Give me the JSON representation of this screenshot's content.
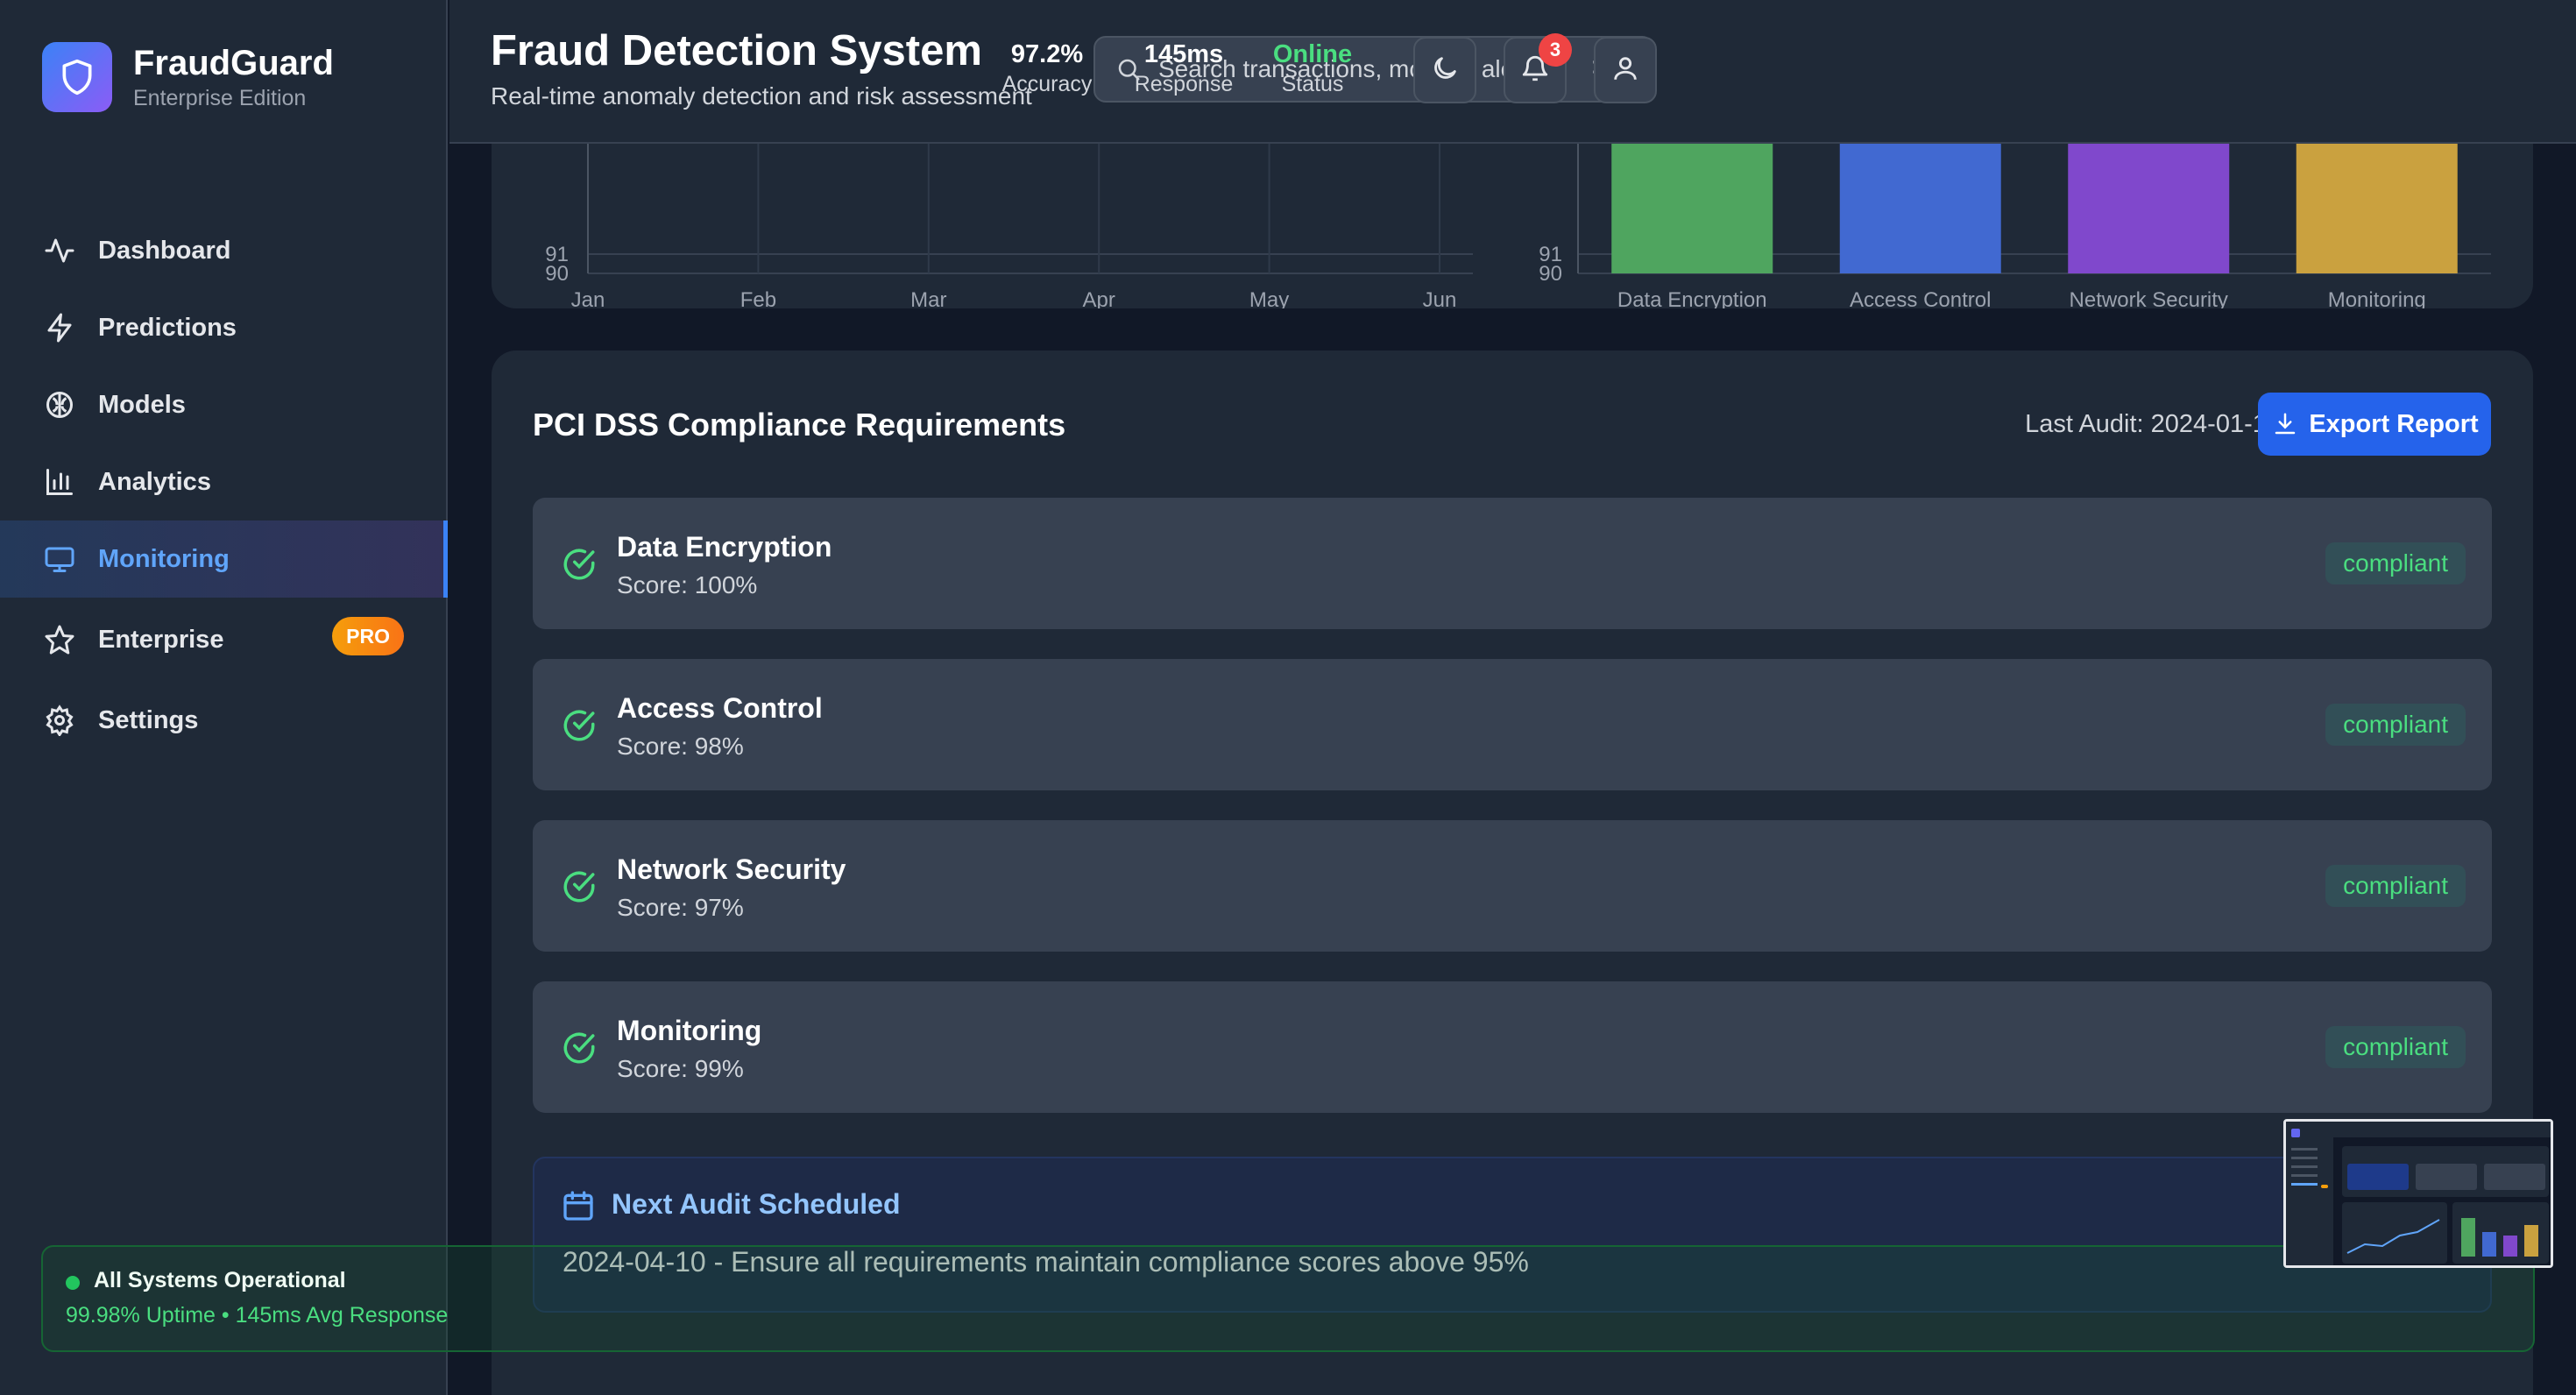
{
  "brand": {
    "name": "FraudGuard",
    "subtitle": "Enterprise Edition"
  },
  "sidebar": {
    "items": [
      {
        "label": "Dashboard",
        "icon": "activity-icon"
      },
      {
        "label": "Predictions",
        "icon": "zap-icon"
      },
      {
        "label": "Models",
        "icon": "brain-icon"
      },
      {
        "label": "Analytics",
        "icon": "bar-chart-icon"
      },
      {
        "label": "Monitoring",
        "icon": "monitor-icon",
        "active": true
      },
      {
        "label": "Enterprise",
        "icon": "star-icon",
        "badge": "PRO"
      },
      {
        "label": "Settings",
        "icon": "gear-icon"
      }
    ]
  },
  "header": {
    "title": "Fraud Detection System",
    "subtitle": "Real-time anomaly detection and risk assessment",
    "search_placeholder": "Search transactions, models, alerts...",
    "search_shortcut": "⌘ K",
    "stats": [
      {
        "value": "97.2%",
        "label": "Accuracy"
      },
      {
        "value": "145ms",
        "label": "Response"
      },
      {
        "value": "Online",
        "label": "Status"
      }
    ],
    "notification_count": "3"
  },
  "chart_data": [
    {
      "type": "line",
      "categories": [
        "Jan",
        "Feb",
        "Mar",
        "Apr",
        "May",
        "Jun"
      ],
      "y_ticks_visible": [
        "91",
        "90"
      ],
      "grid": true
    },
    {
      "type": "bar",
      "categories": [
        "Data Encryption",
        "Access Control",
        "Network Security",
        "Monitoring"
      ],
      "values": [
        100,
        98,
        97,
        99
      ],
      "y_ticks_visible": [
        "91",
        "90"
      ],
      "colors": [
        "#4fa55f",
        "#4169d1",
        "#8048cc",
        "#caa13f"
      ],
      "grid": true
    }
  ],
  "compliance": {
    "title": "PCI DSS Compliance Requirements",
    "last_audit": "Last Audit: 2024-01-10",
    "export_label": "Export Report",
    "requirements": [
      {
        "name": "Data Encryption",
        "score": "Score: 100%",
        "status": "compliant"
      },
      {
        "name": "Access Control",
        "score": "Score: 98%",
        "status": "compliant"
      },
      {
        "name": "Network Security",
        "score": "Score: 97%",
        "status": "compliant"
      },
      {
        "name": "Monitoring",
        "score": "Score: 99%",
        "status": "compliant"
      }
    ],
    "next_audit_title": "Next Audit Scheduled",
    "next_audit_text": "2024-04-10 - Ensure all requirements maintain compliance scores above 95%"
  },
  "system_status": {
    "title": "All Systems Operational",
    "detail": "99.98% Uptime • 145ms Avg Response"
  },
  "colors": {
    "accent": "#2563eb",
    "success": "#4ade80",
    "danger": "#ef4444",
    "pro": "#f59e0b"
  }
}
